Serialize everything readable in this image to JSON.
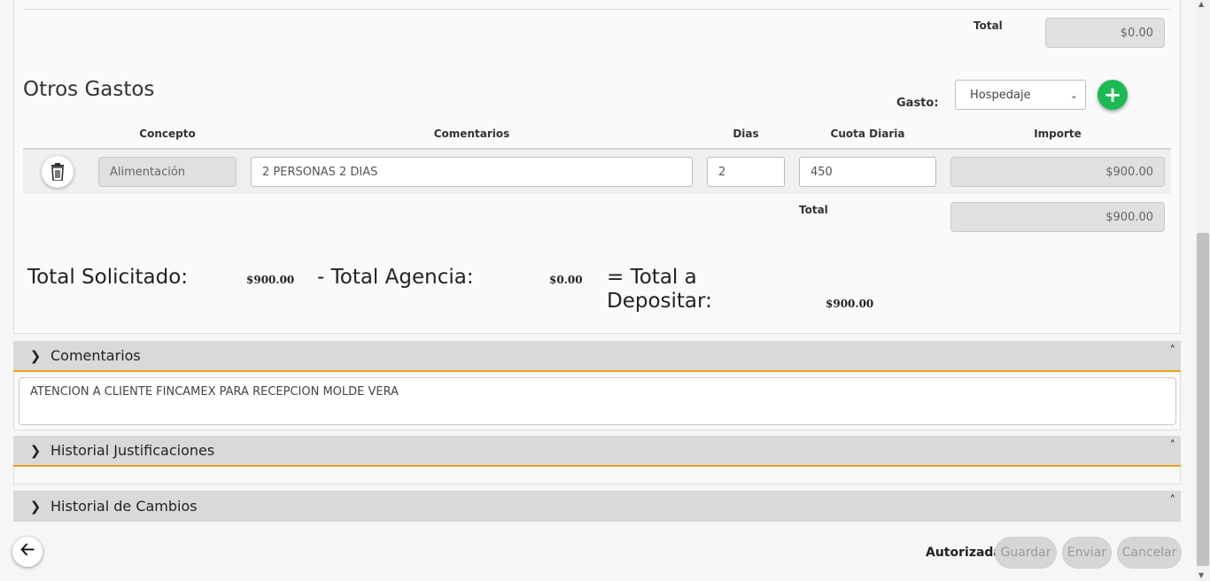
{
  "top_section": {
    "total_label": "Total",
    "total_value": "$0.00"
  },
  "otros_gastos": {
    "title": "Otros Gastos",
    "gasto_label": "Gasto:",
    "gasto_select": "Hospedaje",
    "add_icon": "plus-circle-icon",
    "columns": {
      "concepto": "Concepto",
      "comentarios": "Comentarios",
      "dias": "Dias",
      "cuota": "Cuota Diaria",
      "importe": "Importe"
    },
    "row": {
      "concepto": "Alimentación",
      "comentarios": "2 PERSONAS 2 DIAS",
      "dias": "2",
      "cuota": "450",
      "importe": "$900.00"
    },
    "total_label": "Total",
    "total_value": "$900.00"
  },
  "summary": {
    "solicitado_label": "Total Solicitado:",
    "solicitado_value": "$900.00",
    "agencia_label": "- Total Agencia:",
    "agencia_value": "$0.00",
    "depositar_label_1": "= Total a",
    "depositar_label_2": "Depositar:",
    "depositar_value": "$900.00"
  },
  "comentarios": {
    "title": "Comentarios",
    "text": "ATENCION A CLIENTE FINCAMEX PARA RECEPCION MOLDE VERA"
  },
  "historial_justificaciones": {
    "title": "Historial Justificaciones"
  },
  "historial_cambios": {
    "title": "Historial de Cambios"
  },
  "footer": {
    "status": "Autorizada",
    "guardar": "Guardar",
    "enviar": "Enviar",
    "cancelar": "Cancelar"
  },
  "colors": {
    "accent_border": "#e8a317",
    "add_button": "#1db954"
  }
}
